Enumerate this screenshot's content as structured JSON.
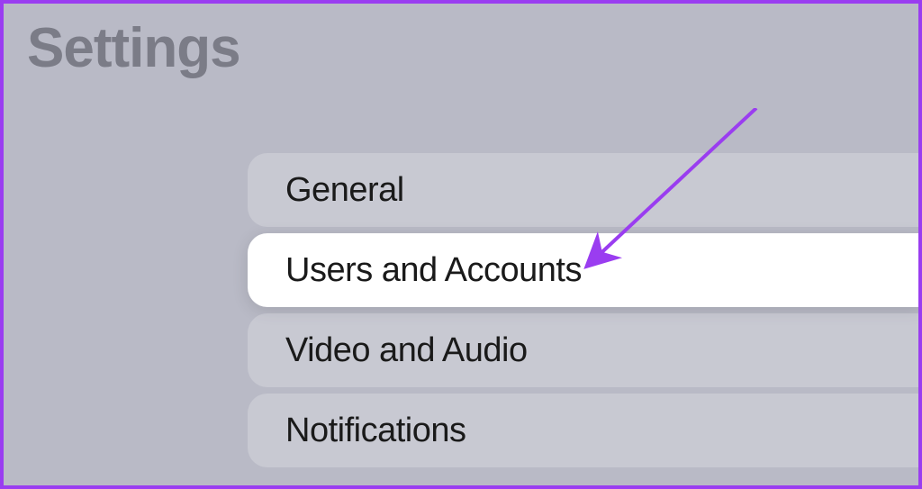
{
  "title": "Settings",
  "menu": {
    "items": [
      {
        "label": "General",
        "focused": false
      },
      {
        "label": "Users and Accounts",
        "focused": true
      },
      {
        "label": "Video and Audio",
        "focused": false
      },
      {
        "label": "Notifications",
        "focused": false
      }
    ]
  },
  "annotation": {
    "arrow_color": "#9a3df0"
  }
}
